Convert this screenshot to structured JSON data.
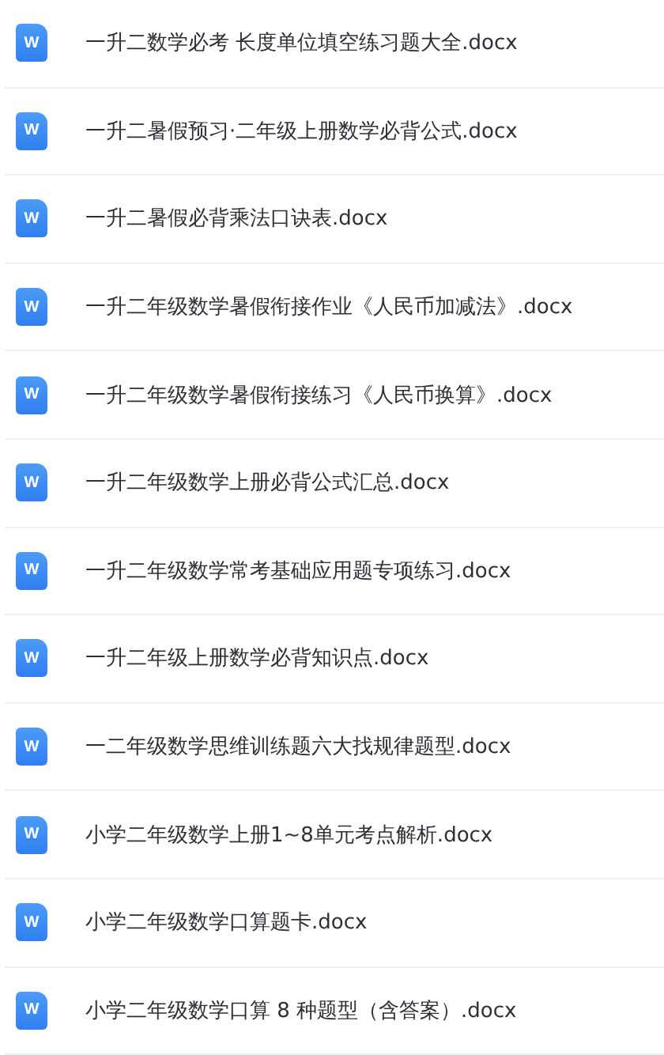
{
  "files": [
    {
      "icon": "W",
      "name": "一升二数学必考 长度单位填空练习题大全.docx"
    },
    {
      "icon": "W",
      "name": "一升二暑假预习·二年级上册数学必背公式.docx"
    },
    {
      "icon": "W",
      "name": "一升二暑假必背乘法口诀表.docx"
    },
    {
      "icon": "W",
      "name": "一升二年级数学暑假衔接作业《人民币加减法》.docx"
    },
    {
      "icon": "W",
      "name": "一升二年级数学暑假衔接练习《人民币换算》.docx"
    },
    {
      "icon": "W",
      "name": "一升二年级数学上册必背公式汇总.docx"
    },
    {
      "icon": "W",
      "name": "一升二年级数学常考基础应用题专项练习.docx"
    },
    {
      "icon": "W",
      "name": "一升二年级上册数学必背知识点.docx"
    },
    {
      "icon": "W",
      "name": "一二年级数学思维训练题六大找规律题型.docx"
    },
    {
      "icon": "W",
      "name": "小学二年级数学上册1~8单元考点解析.docx"
    },
    {
      "icon": "W",
      "name": "小学二年级数学口算题卡.docx"
    },
    {
      "icon": "W",
      "name": "小学二年级数学口算 8 种题型（含答案）.docx"
    }
  ]
}
